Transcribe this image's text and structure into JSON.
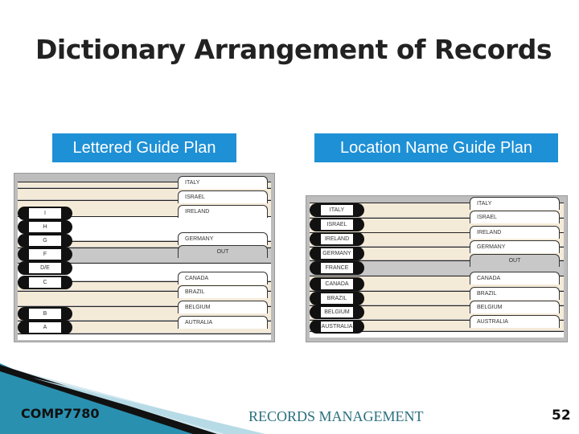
{
  "title": "Dictionary Arrangement of Records",
  "left": {
    "caption": "Lettered Guide Plan",
    "folders": [
      "ITALY",
      "ISRAEL",
      "IRELAND",
      "GERMANY",
      "OUT",
      "CANADA",
      "BRAZIL",
      "BELGIUM",
      "AUTRALIA"
    ],
    "guides": [
      "I",
      "H",
      "G",
      "F",
      "D/E",
      "C",
      "B",
      "A"
    ]
  },
  "right": {
    "caption": "Location Name Guide Plan",
    "folders": [
      "ITALY",
      "ISRAEL",
      "IRELAND",
      "GERMANY",
      "OUT",
      "CANADA",
      "BRAZIL",
      "BELGIUM",
      "AUSTRALIA"
    ],
    "guides": [
      "ITALY",
      "ISRAEL",
      "IRELAND",
      "GERMANY",
      "FRANCE",
      "CANADA",
      "BRAZIL",
      "BELGIUM",
      "AUSTRALIA"
    ]
  },
  "footer": {
    "course": "COMP7780",
    "title": "RECORDS MANAGEMENT",
    "page": "52"
  },
  "colors": {
    "caption_bg": "#1e90d6",
    "folder": "#f4ead8",
    "out_guide": "#c8c8c8",
    "footer_text": "#2a6f7f"
  }
}
